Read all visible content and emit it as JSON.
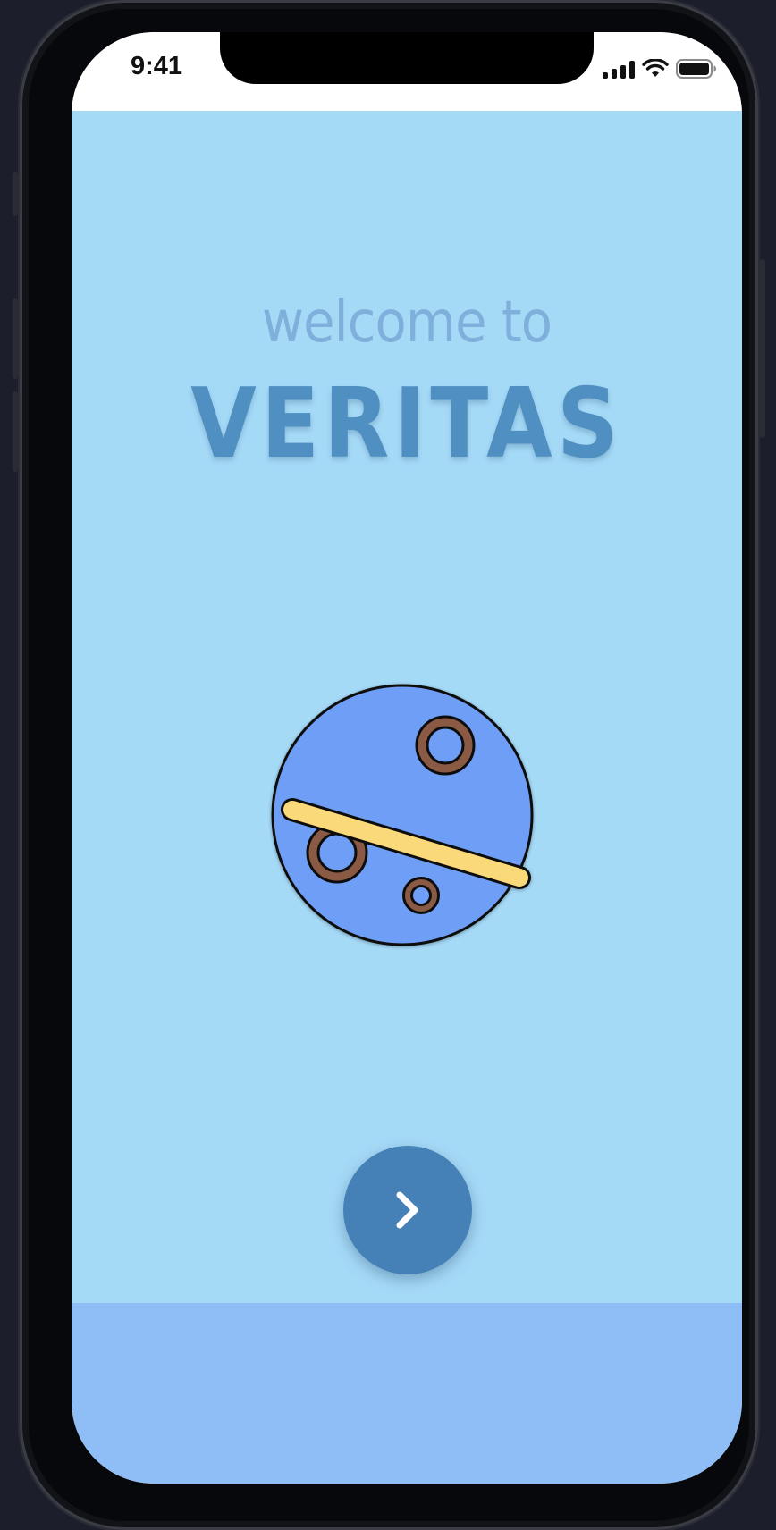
{
  "status_bar": {
    "time": "9:41",
    "icons": [
      "cellular-signal-icon",
      "wifi-icon",
      "battery-icon"
    ]
  },
  "welcome": {
    "subtitle": "welcome to",
    "title": "VERITAS"
  },
  "illustration": {
    "name": "planet-illustration",
    "colors": {
      "planet": "#6e9ef5",
      "ring": "#f9d97a",
      "crater": "#8a5a45",
      "outline": "#111111"
    }
  },
  "next_button": {
    "icon": "chevron-right-icon",
    "color": "#4581b6"
  },
  "colors": {
    "background": "#a5daf7",
    "bottom_panel": "#8fbef7",
    "subtitle": "#7fb0db",
    "title": "#4f8fc2"
  }
}
